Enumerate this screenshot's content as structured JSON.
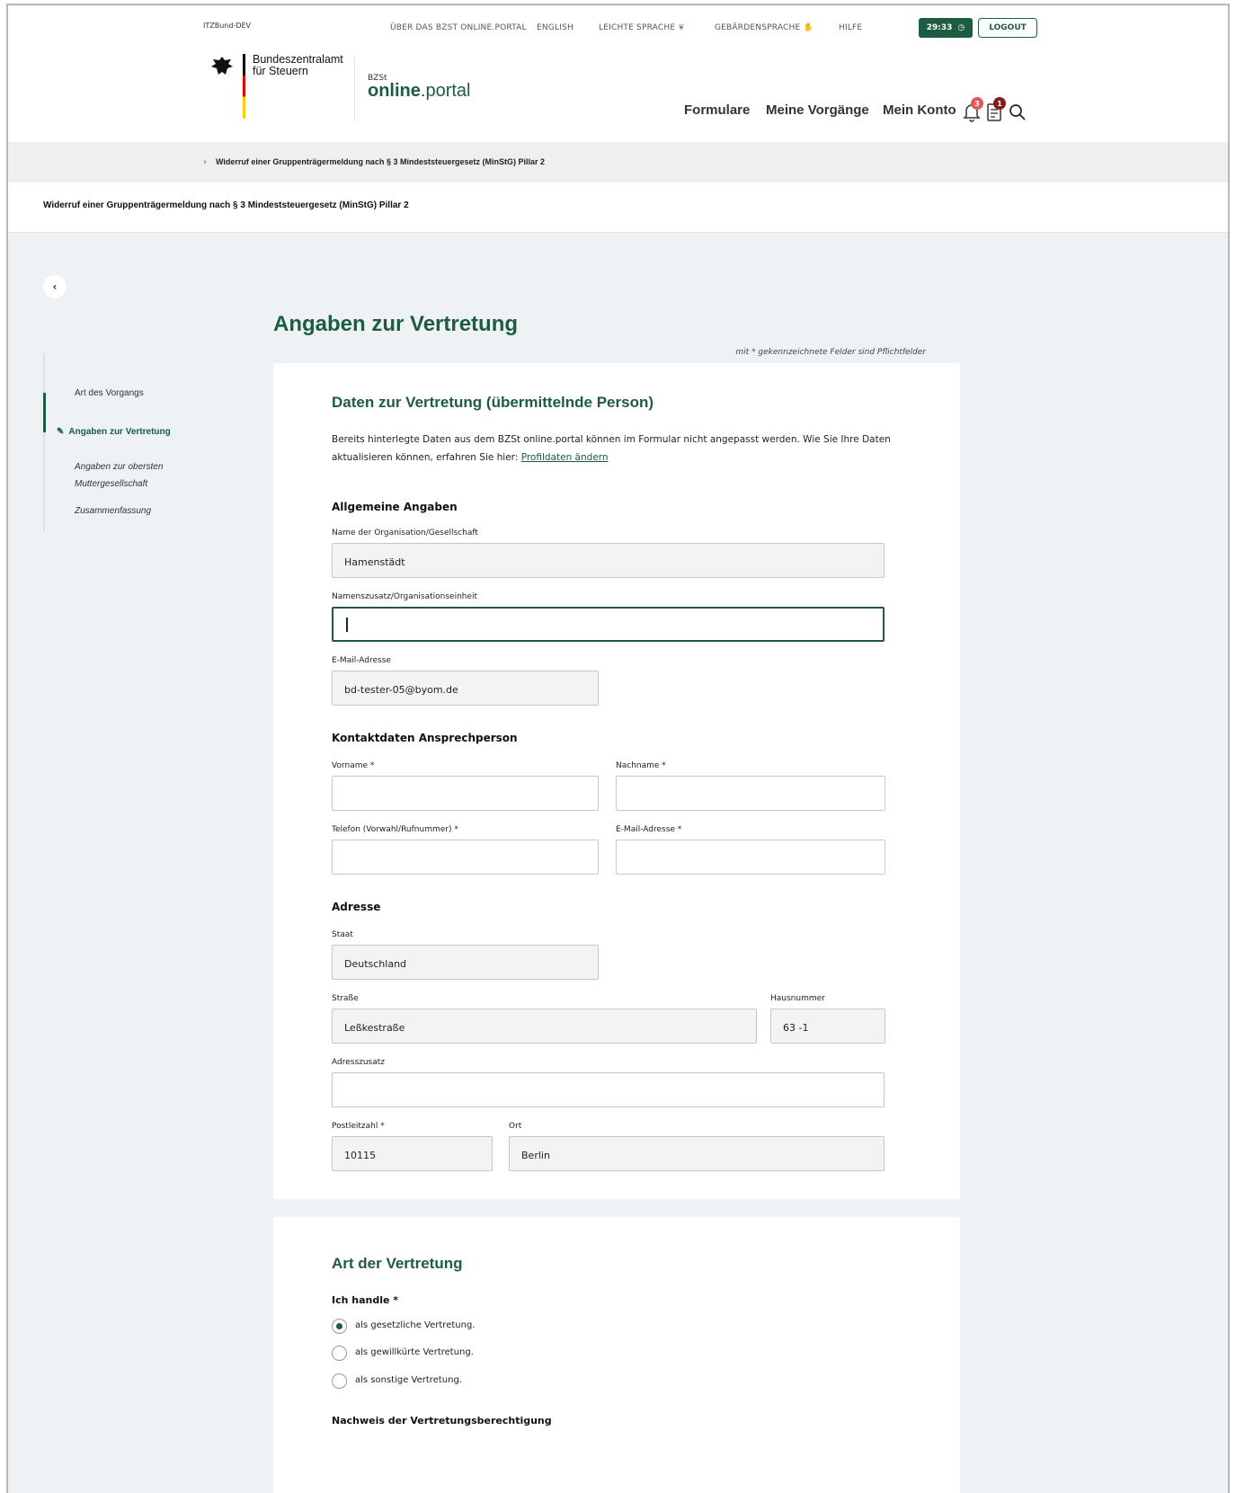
{
  "env_label": "ITZBund-DEV",
  "topnav": [
    "ÜBER DAS BZST ONLINE.PORTAL",
    "ENGLISH",
    "LEICHTE SPRACHE",
    "GEBÄRDENSPRACHE",
    "HILFE"
  ],
  "timer": "29:33",
  "logout": "LOGOUT",
  "logo": {
    "line1": "Bundeszentralamt",
    "line2": "für Steuern",
    "bz_small": "BZSt",
    "bz_bold": "online",
    "bz_rest": ".portal"
  },
  "mainnav": [
    "Formulare",
    "Meine Vorgänge",
    "Mein Konto"
  ],
  "badges": {
    "notifications": "3",
    "documents": "1"
  },
  "breadcrumb": "Widerruf einer Gruppenträgermeldung nach § 3 Mindeststeuergesetz (MinStG) Pillar 2",
  "page_title": "Widerruf einer Gruppenträgermeldung nach § 3 Mindeststeuergesetz (MinStG) Pillar 2",
  "heading": "Angaben zur Vertretung",
  "required_note": "mit * gekennzeichnete Felder sind Pflichtfelder",
  "sidebar": [
    {
      "label": "Art des Vorgangs"
    },
    {
      "label": "Angaben zur Vertretung"
    },
    {
      "label1": "Angaben zur obersten",
      "label2": "Muttergesellschaft"
    },
    {
      "label": "Zusammenfassung"
    }
  ],
  "card1": {
    "title": "Daten zur Vertretung (übermittelnde Person)",
    "info_line1": "Bereits hinterlegte Daten aus dem BZSt online.portal können im Formular nicht angepasst werden. Wie Sie Ihre Daten",
    "info_line2": "aktualisieren können, erfahren Sie hier: ",
    "info_link": "Profildaten ändern",
    "sec_general": "Allgemeine Angaben",
    "lbl_org": "Name der Organisation/Gesellschaft",
    "val_org": "Hamenstädt",
    "lbl_unit": "Namenszusatz/Organisationseinheit",
    "lbl_email": "E-Mail-Adresse",
    "val_email": "bd-tester-05@byom.de",
    "sec_contact": "Kontaktdaten Ansprechperson",
    "lbl_first": "Vorname *",
    "lbl_last": "Nachname *",
    "lbl_phone": "Telefon (Vorwahl/Rufnummer) *",
    "lbl_cemail": "E-Mail-Adresse *",
    "sec_address": "Adresse",
    "lbl_country": "Staat",
    "val_country": "Deutschland",
    "lbl_street": "Straße",
    "val_street": "Leßkestraße",
    "lbl_house": "Hausnummer",
    "val_house": "63 -1",
    "lbl_extra": "Adresszusatz",
    "lbl_zip": "Postleitzahl *",
    "val_zip": "10115",
    "lbl_city": "Ort",
    "val_city": "Berlin"
  },
  "card2": {
    "title": "Art der Vertretung",
    "question": "Ich handle *",
    "options": [
      "als gesetzliche Vertretung.",
      "als gewillkürte Vertretung.",
      "als sonstige Vertretung."
    ],
    "selected_index": 0,
    "proof": "Nachweis der Vertretungsberechtigung"
  }
}
